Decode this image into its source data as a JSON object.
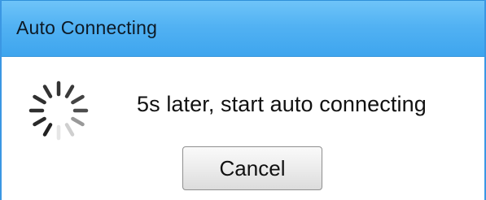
{
  "dialog": {
    "title": "Auto Connecting",
    "message": "5s later, start auto connecting",
    "cancel_label": "Cancel",
    "spinner_icon": "loading-spinner-icon"
  },
  "colors": {
    "titlebar": "#52b2f3",
    "border": "#3b97e3",
    "text": "#111111"
  }
}
